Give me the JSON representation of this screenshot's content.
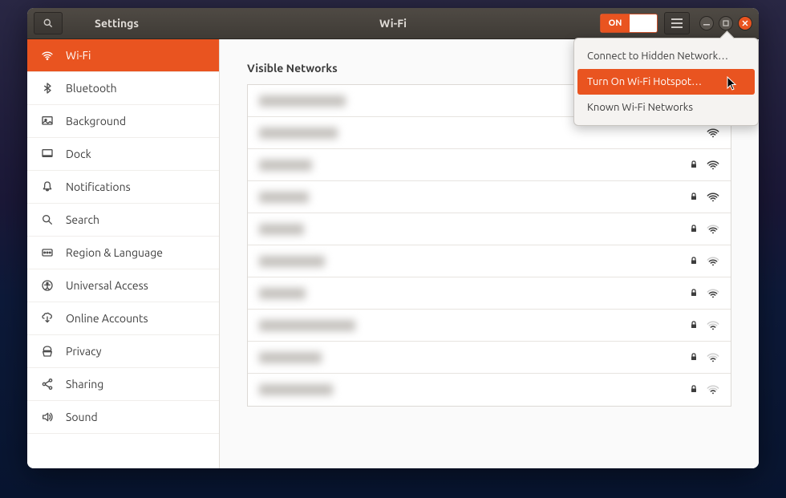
{
  "titlebar": {
    "app_title": "Settings",
    "panel_title": "Wi-Fi",
    "toggle_on_label": "ON"
  },
  "sidebar": {
    "items": [
      {
        "label": "Wi-Fi",
        "icon": "wifi",
        "active": true
      },
      {
        "label": "Bluetooth",
        "icon": "bluetooth",
        "active": false
      },
      {
        "label": "Background",
        "icon": "background",
        "active": false
      },
      {
        "label": "Dock",
        "icon": "dock",
        "active": false
      },
      {
        "label": "Notifications",
        "icon": "bell",
        "active": false
      },
      {
        "label": "Search",
        "icon": "search",
        "active": false
      },
      {
        "label": "Region & Language",
        "icon": "region",
        "active": false
      },
      {
        "label": "Universal Access",
        "icon": "universal",
        "active": false
      },
      {
        "label": "Online Accounts",
        "icon": "online",
        "active": false
      },
      {
        "label": "Privacy",
        "icon": "privacy",
        "active": false
      },
      {
        "label": "Sharing",
        "icon": "sharing",
        "active": false
      },
      {
        "label": "Sound",
        "icon": "sound",
        "active": false
      }
    ]
  },
  "content": {
    "section_title": "Visible Networks",
    "networks": [
      {
        "blur_width": 108,
        "locked": false,
        "strength": 4
      },
      {
        "blur_width": 98,
        "locked": false,
        "strength": 4
      },
      {
        "blur_width": 66,
        "locked": true,
        "strength": 4
      },
      {
        "blur_width": 62,
        "locked": true,
        "strength": 4
      },
      {
        "blur_width": 56,
        "locked": true,
        "strength": 3
      },
      {
        "blur_width": 82,
        "locked": true,
        "strength": 3
      },
      {
        "blur_width": 58,
        "locked": true,
        "strength": 3
      },
      {
        "blur_width": 120,
        "locked": true,
        "strength": 2
      },
      {
        "blur_width": 78,
        "locked": true,
        "strength": 2
      },
      {
        "blur_width": 92,
        "locked": true,
        "strength": 2
      }
    ]
  },
  "popover": {
    "items": [
      {
        "label": "Connect to Hidden Network…",
        "hover": false
      },
      {
        "label": "Turn On Wi-Fi Hotspot…",
        "hover": true
      },
      {
        "label": "Known Wi-Fi Networks",
        "hover": false
      }
    ]
  },
  "colors": {
    "accent": "#e95420"
  }
}
